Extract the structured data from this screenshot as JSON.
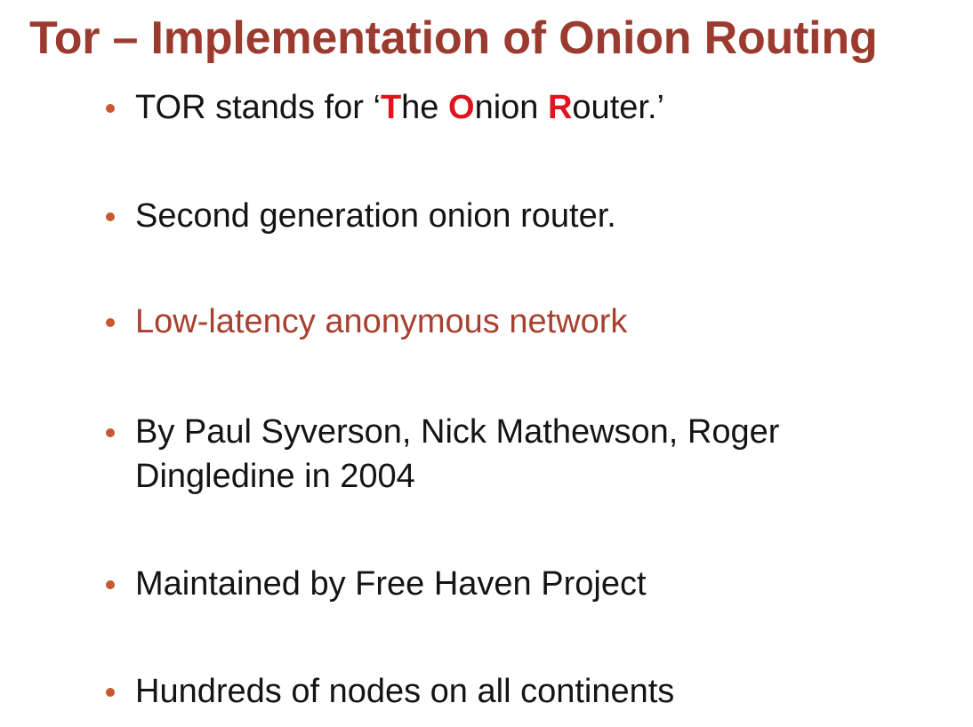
{
  "colors": {
    "title": "#9b3a2e",
    "bullet_marker": "#c8582f",
    "text": "#141414",
    "highlight_letter": "#e0141e",
    "accent_text": "#a8402f"
  },
  "slide": {
    "title": "Tor – Implementation of Onion Routing",
    "bullets": [
      {
        "segments": [
          {
            "text": "TOR stands for ‘"
          },
          {
            "text": "T",
            "highlight": true
          },
          {
            "text": "he "
          },
          {
            "text": "O",
            "highlight": true
          },
          {
            "text": "nion "
          },
          {
            "text": "R",
            "highlight": true
          },
          {
            "text": "outer.’"
          }
        ]
      },
      {
        "line1": "Second generation onion router."
      },
      {
        "line1": "Low-latency anonymous network",
        "accent": true
      },
      {
        "line1": "By Paul Syverson, Nick Mathewson, Roger",
        "line2": "Dingledine in 2004"
      },
      {
        "line1": "Maintained by Free Haven Project"
      },
      {
        "line1": "Hundreds of nodes on all continents"
      }
    ]
  }
}
